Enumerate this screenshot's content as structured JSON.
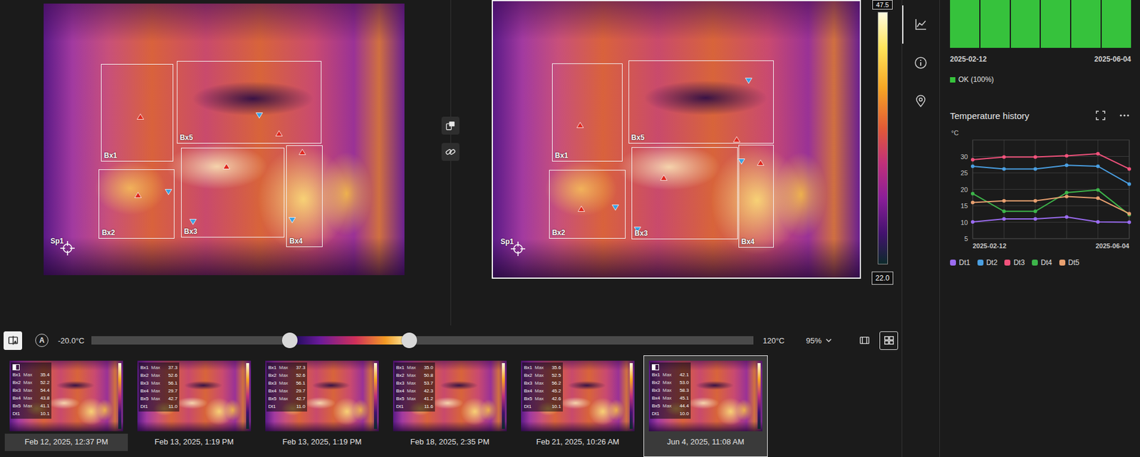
{
  "viewer": {
    "images": [
      {
        "selected": false,
        "overlays": [
          {
            "label": "Bx1",
            "kind": "box"
          },
          {
            "label": "Bx2",
            "kind": "box"
          },
          {
            "label": "Bx3",
            "kind": "box"
          },
          {
            "label": "Bx4",
            "kind": "box"
          },
          {
            "label": "Bx5",
            "kind": "box"
          },
          {
            "label": "Sp1",
            "kind": "spot"
          }
        ]
      },
      {
        "selected": true,
        "overlays": [
          {
            "label": "Bx1",
            "kind": "box"
          },
          {
            "label": "Bx2",
            "kind": "box"
          },
          {
            "label": "Bx3",
            "kind": "box"
          },
          {
            "label": "Bx4",
            "kind": "box"
          },
          {
            "label": "Bx5",
            "kind": "box"
          },
          {
            "label": "Sp1",
            "kind": "spot"
          }
        ]
      }
    ],
    "scale": {
      "max": "47.5",
      "min": "22.0"
    }
  },
  "toolbar": {
    "compare_toggle": {
      "selected": true
    },
    "auto_button": {
      "label": "A"
    },
    "range_min": "-20.0°C",
    "range_max": "120°C",
    "range": {
      "low": 0.3,
      "high": 0.48
    },
    "opacity": "95%",
    "view_buttons": [
      {
        "kind": "frame",
        "selected": false
      },
      {
        "kind": "grid",
        "selected": true
      }
    ]
  },
  "thumbnails": [
    {
      "date": "Feb 12, 2025, 12:37 PM",
      "compared": true,
      "selected": false,
      "rows": [
        {
          "label": "Bx1",
          "stat": "Max",
          "value": "35.4"
        },
        {
          "label": "Bx2",
          "stat": "Max",
          "value": "52.2"
        },
        {
          "label": "Bx3",
          "stat": "Max",
          "value": "54.4"
        },
        {
          "label": "Bx4",
          "stat": "Max",
          "value": "43.8"
        },
        {
          "label": "Bx5",
          "stat": "Max",
          "value": "41.1"
        },
        {
          "label": "Dt1",
          "value": "10.1"
        }
      ]
    },
    {
      "date": "Feb 13, 2025, 1:19 PM",
      "compared": false,
      "selected": false,
      "rows": [
        {
          "label": "Bx1",
          "stat": "Max",
          "value": "37.3"
        },
        {
          "label": "Bx2",
          "stat": "Max",
          "value": "52.6"
        },
        {
          "label": "Bx3",
          "stat": "Max",
          "value": "56.1"
        },
        {
          "label": "Bx4",
          "stat": "Max",
          "value": "29.7"
        },
        {
          "label": "Bx5",
          "stat": "Max",
          "value": "42.7"
        },
        {
          "label": "Dt1",
          "value": "11.0"
        }
      ]
    },
    {
      "date": "Feb 13, 2025, 1:19 PM",
      "compared": false,
      "selected": false,
      "rows": [
        {
          "label": "Bx1",
          "stat": "Max",
          "value": "37.3"
        },
        {
          "label": "Bx2",
          "stat": "Max",
          "value": "52.6"
        },
        {
          "label": "Bx3",
          "stat": "Max",
          "value": "56.1"
        },
        {
          "label": "Bx4",
          "stat": "Max",
          "value": "29.7"
        },
        {
          "label": "Bx5",
          "stat": "Max",
          "value": "42.7"
        },
        {
          "label": "Dt1",
          "value": "11.0"
        }
      ]
    },
    {
      "date": "Feb 18, 2025, 2:35 PM",
      "compared": false,
      "selected": false,
      "rows": [
        {
          "label": "Bx1",
          "stat": "Max",
          "value": "35.0"
        },
        {
          "label": "Bx2",
          "stat": "Max",
          "value": "50.8"
        },
        {
          "label": "Bx3",
          "stat": "Max",
          "value": "53.7"
        },
        {
          "label": "Bx4",
          "stat": "Max",
          "value": "42.3"
        },
        {
          "label": "Bx5",
          "stat": "Max",
          "value": "41.2"
        },
        {
          "label": "Dt1",
          "value": "11.6"
        }
      ]
    },
    {
      "date": "Feb 21, 2025, 10:26 AM",
      "compared": false,
      "selected": false,
      "rows": [
        {
          "label": "Bx1",
          "stat": "Max",
          "value": "35.6"
        },
        {
          "label": "Bx2",
          "stat": "Max",
          "value": "52.5"
        },
        {
          "label": "Bx3",
          "stat": "Max",
          "value": "56.2"
        },
        {
          "label": "Bx4",
          "stat": "Max",
          "value": "45.2"
        },
        {
          "label": "Bx5",
          "stat": "Max",
          "value": "42.6"
        },
        {
          "label": "Dt1",
          "value": "10.1"
        }
      ]
    },
    {
      "date": "Jun 4, 2025, 11:08 AM",
      "compared": false,
      "selected": true,
      "rows": [
        {
          "label": "Bx1",
          "stat": "Max",
          "value": "42.1"
        },
        {
          "label": "Bx2",
          "stat": "Max",
          "value": "53.0"
        },
        {
          "label": "Bx3",
          "stat": "Max",
          "value": "58.3"
        },
        {
          "label": "Bx4",
          "stat": "Max",
          "value": "45.1"
        },
        {
          "label": "Bx5",
          "stat": "Max",
          "value": "44.4"
        },
        {
          "label": "Dt1",
          "value": "10.0"
        }
      ]
    }
  ],
  "nav": [
    {
      "kind": "chart",
      "selected": true
    },
    {
      "kind": "info",
      "selected": false
    },
    {
      "kind": "location",
      "selected": false
    }
  ],
  "side": {
    "status_chart": {
      "bars": [
        {
          "level": 1
        },
        {
          "level": 1
        },
        {
          "level": 1
        },
        {
          "level": 1
        },
        {
          "level": 1
        },
        {
          "level": 1
        }
      ],
      "start": "2025-02-12",
      "end": "2025-06-04",
      "legend": [
        {
          "label": "OK (100%)",
          "color": "#36c23c"
        }
      ]
    },
    "temperature_history": {
      "title": "Temperature history",
      "unit": "°C",
      "ticks": [
        "30",
        "25",
        "20",
        "15",
        "10",
        "5"
      ],
      "start": "2025-02-12",
      "end": "2025-06-04",
      "series": [
        {
          "name": "Dt1",
          "color": "#9b6cf2",
          "values": [
            10.1,
            11.0,
            11.0,
            11.6,
            10.1,
            10.0
          ]
        },
        {
          "name": "Dt2",
          "color": "#4a9fe2",
          "values": [
            27.0,
            26.2,
            26.2,
            27.3,
            27.0,
            21.6
          ]
        },
        {
          "name": "Dt3",
          "color": "#f2527c",
          "values": [
            29.0,
            29.8,
            29.8,
            30.2,
            30.8,
            26.2
          ]
        },
        {
          "name": "Dt4",
          "color": "#3db54a",
          "values": [
            18.7,
            13.3,
            13.3,
            19.0,
            19.8,
            12.3
          ]
        },
        {
          "name": "Dt5",
          "color": "#e8a070",
          "values": [
            16.0,
            16.5,
            16.5,
            17.8,
            17.3,
            12.6
          ]
        }
      ]
    }
  }
}
